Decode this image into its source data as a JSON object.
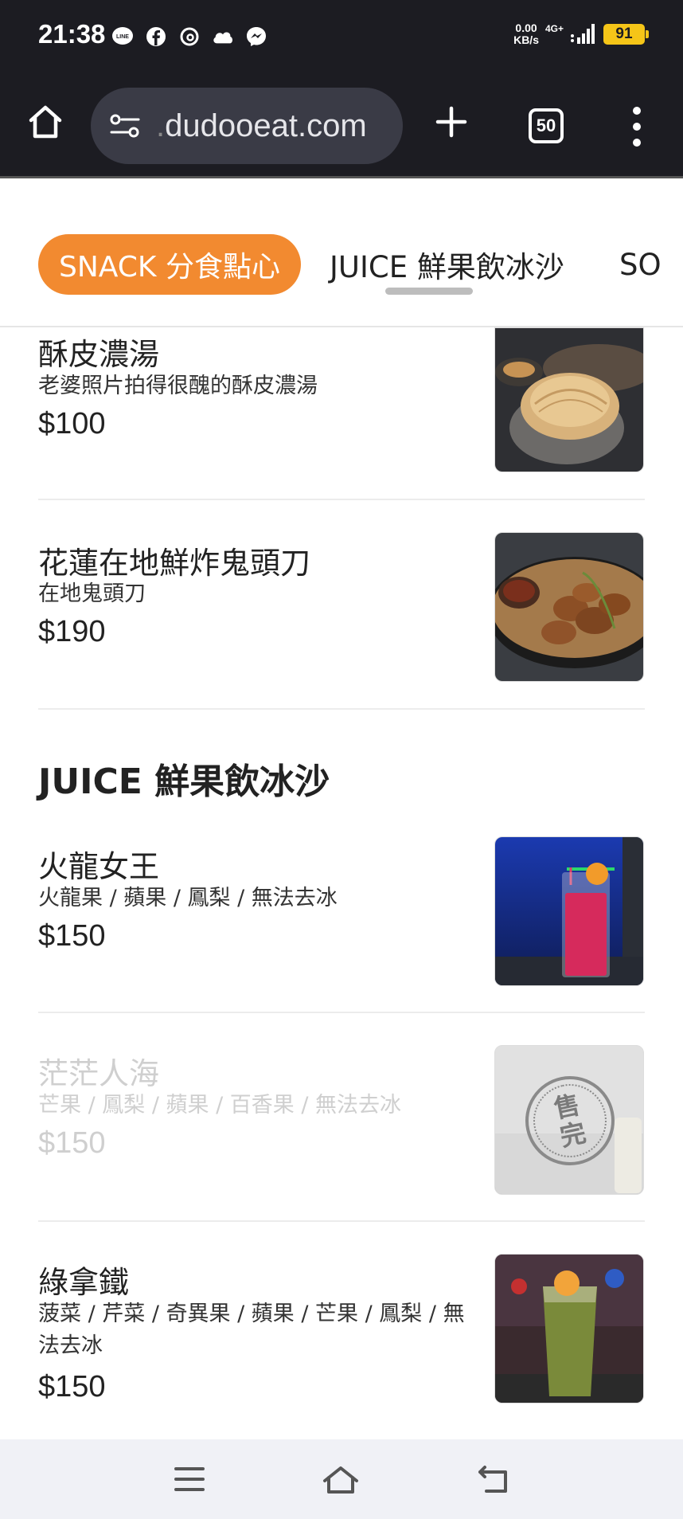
{
  "status_bar": {
    "time": "21:38",
    "apps": [
      "line-icon",
      "facebook-icon",
      "threads-icon",
      "cloud-icon",
      "messenger-icon"
    ],
    "net_speed_value": "0.00",
    "net_speed_unit": "KB/s",
    "network_type": "4G+",
    "battery": "91"
  },
  "browser": {
    "url_dot": ".",
    "url": "dudooeat.com",
    "tab_count": "50"
  },
  "categories": {
    "active": "SNACK 分食點心",
    "juice": "JUICE 鮮果飲冰沙",
    "next_partial": "SO"
  },
  "items": [
    {
      "name": "酥皮濃湯",
      "desc": "老婆照片拍得很醜的酥皮濃湯",
      "price": "$100"
    },
    {
      "name": "花蓮在地鮮炸鬼頭刀",
      "desc": "在地鬼頭刀",
      "price": "$190"
    }
  ],
  "section_juice": {
    "title": "JUICE 鮮果飲冰沙"
  },
  "juice_items": [
    {
      "name": "火龍女王",
      "desc": "火龍果 / 蘋果 / 鳳梨 / 無法去冰",
      "price": "$150"
    },
    {
      "name": "茫茫人海",
      "desc": "芒果 / 鳳梨 / 蘋果 / 百香果 / 無法去冰",
      "price": "$150",
      "stamp": "售完"
    },
    {
      "name": "綠拿鐵",
      "desc": "菠菜 / 芹菜 / 奇異果 / 蘋果 / 芒果 / 鳳梨 / 無法去冰",
      "price": "$150"
    }
  ],
  "colors": {
    "accent": "#f28a30",
    "browser_bg": "#1c1c22",
    "battery": "#f5c518"
  }
}
